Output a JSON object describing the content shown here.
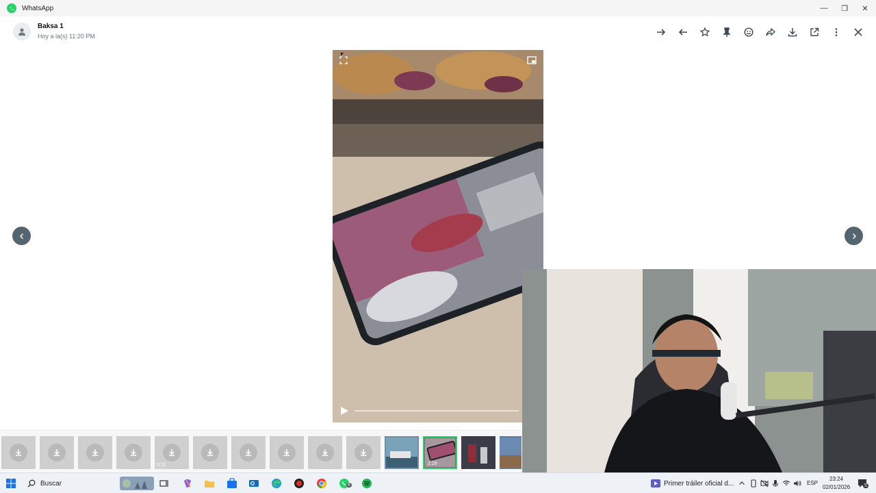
{
  "window": {
    "title": "WhatsApp",
    "minimize_glyph": "—",
    "maximize_glyph": "❐",
    "close_glyph": "✕"
  },
  "chat_header": {
    "contact_name": "Baksa 1",
    "status": "Hoy a la(s) 11:20 PM",
    "toolbar_icons": [
      "arrow-right-icon",
      "reply-icon",
      "star-icon",
      "pin-icon",
      "emoji-icon",
      "forward-icon",
      "download-icon",
      "open-external-icon",
      "more-icon",
      "close-icon"
    ]
  },
  "media_viewer": {
    "content": "video frame: phone on table showing street scene with cars",
    "progress": 0
  },
  "thumbnails": {
    "download_count": 10,
    "video_badge_1": "0:11",
    "video_badge_2": "2:29"
  },
  "taskbar": {
    "search_placeholder": "Buscar",
    "media_title": "Primer tráiler oficial d...",
    "language": "ESP",
    "time": "23:24",
    "date": "02/01/2026",
    "whatsapp_badge": "6",
    "notification_badge": "5"
  },
  "colors": {
    "accent": "#25d366",
    "icon_dark": "#3b4a54",
    "nav_button": "#54656f"
  }
}
